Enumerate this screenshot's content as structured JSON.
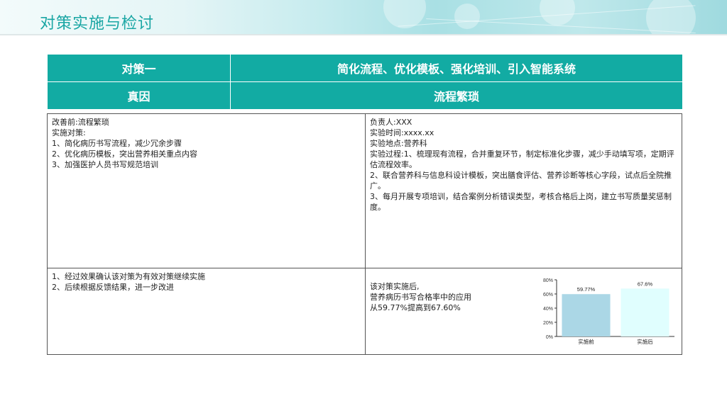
{
  "title": "对策实施与检讨",
  "header": {
    "row1_label": "对策一",
    "row1_value": "简化流程、优化模板、强化培训、引入智能系统",
    "row2_label": "真因",
    "row2_value": "流程繁琐"
  },
  "left_top": {
    "lines": [
      "改善前:流程繁琐",
      "实施对策:",
      "1、简化病历书写流程，减少冗余步骤",
      "2、优化病历模板，突出营养相关重点内容",
      "3、加强医护人员书写规范培训"
    ]
  },
  "right_top": {
    "lines": [
      "负责人:XXX",
      "实验时间:xxxx.xx",
      "实验地点:营养科",
      "实验过程:1、梳理现有流程，合并重复环节，制定标准化步骤，减少手动填写项，定期评估流程效率。",
      "2、联合营养科与信息科设计模板，突出膳食评估、营养诊断等核心字段，试点后全院推广。",
      "3、每月开展专项培训，结合案例分析错误类型，考核合格后上岗，建立书写质量奖惩制度。"
    ]
  },
  "left_bottom": {
    "lines": [
      "1、经过效果确认该对策为有效对策继续实施",
      "2、后续根据反馈结果，进一步改进"
    ]
  },
  "right_bottom": {
    "lines": [
      "该对策实施后,",
      "营养病历书写合格率中的应用",
      "从59.77%提高到67.60%"
    ]
  },
  "chart_data": {
    "type": "bar",
    "categories": [
      "实施前",
      "实施后"
    ],
    "values": [
      59.77,
      67.6
    ],
    "value_labels": [
      "59.77%",
      "67.6%"
    ],
    "colors": [
      "#abd7e6",
      "#e0fefe"
    ],
    "ylim": [
      0,
      80
    ],
    "yticks": [
      "0%",
      "20%",
      "40%",
      "60%",
      "80%"
    ],
    "grid": false
  }
}
